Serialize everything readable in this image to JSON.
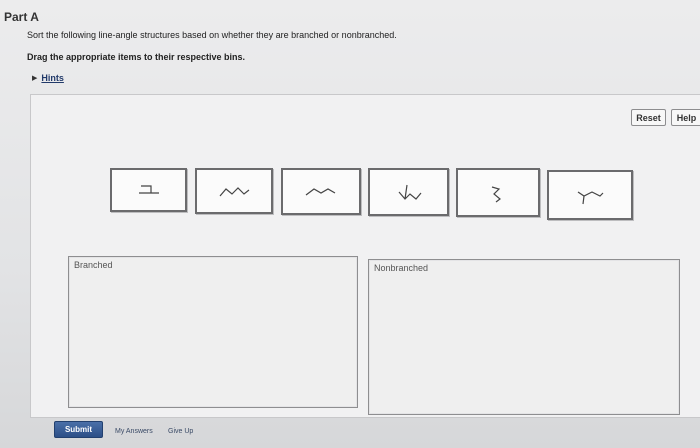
{
  "part": {
    "title": "Part A"
  },
  "instructions": {
    "sort_text": "Sort the following line-angle structures based on whether they are branched or nonbranched.",
    "drag_text": "Drag the appropriate items to their respective bins."
  },
  "hints": {
    "label": "Hints",
    "icon": "triangle-right-icon"
  },
  "toolbar": {
    "reset_label": "Reset",
    "help_label": "Help"
  },
  "items": [
    {
      "name": "structure-item-1"
    },
    {
      "name": "structure-item-2"
    },
    {
      "name": "structure-item-3"
    },
    {
      "name": "structure-item-4"
    },
    {
      "name": "structure-item-5"
    },
    {
      "name": "structure-item-6"
    }
  ],
  "bins": {
    "branched": {
      "label": "Branched"
    },
    "nonbranched": {
      "label": "Nonbranched"
    }
  },
  "footer": {
    "submit_label": "Submit",
    "my_answers_label": "My Answers",
    "give_up_label": "Give Up"
  }
}
